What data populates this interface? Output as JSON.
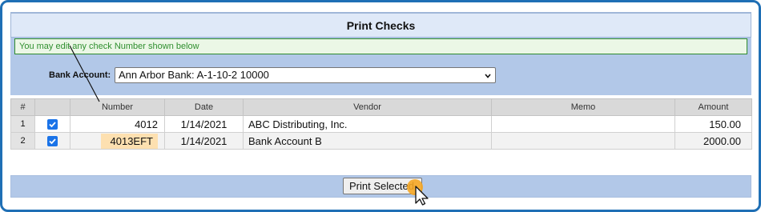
{
  "dialog": {
    "title": "Print Checks",
    "notice": "You may edit any check Number shown below"
  },
  "bank": {
    "label": "Bank Account:",
    "selected": "Ann Arbor Bank: A-1-10-2 10000"
  },
  "table": {
    "columns": [
      "#",
      "",
      "Number",
      "Date",
      "Vendor",
      "Memo",
      "Amount"
    ],
    "rows": [
      {
        "index": "1",
        "selected": true,
        "number": "4012",
        "date": "1/14/2021",
        "vendor": "ABC Distributing, Inc.",
        "memo": "",
        "amount": "150.00"
      },
      {
        "index": "2",
        "selected": true,
        "number": "4013EFT",
        "date": "1/14/2021",
        "vendor": "Bank Account B",
        "memo": "",
        "amount": "2000.00"
      }
    ]
  },
  "footer": {
    "print_label": "Print Selected"
  },
  "colors": {
    "frame": "#1f6fb5",
    "panel": "#b2c8e8",
    "notice_text": "#2f8f2f",
    "checkbox": "#1a73e8",
    "number_highlight": "#fde0b0",
    "cursor_highlight": "#f5a623"
  },
  "icons": {
    "select_arrow": "chevron-down-icon",
    "checkbox": "checkmark-icon",
    "cursor": "mouse-pointer-icon"
  }
}
